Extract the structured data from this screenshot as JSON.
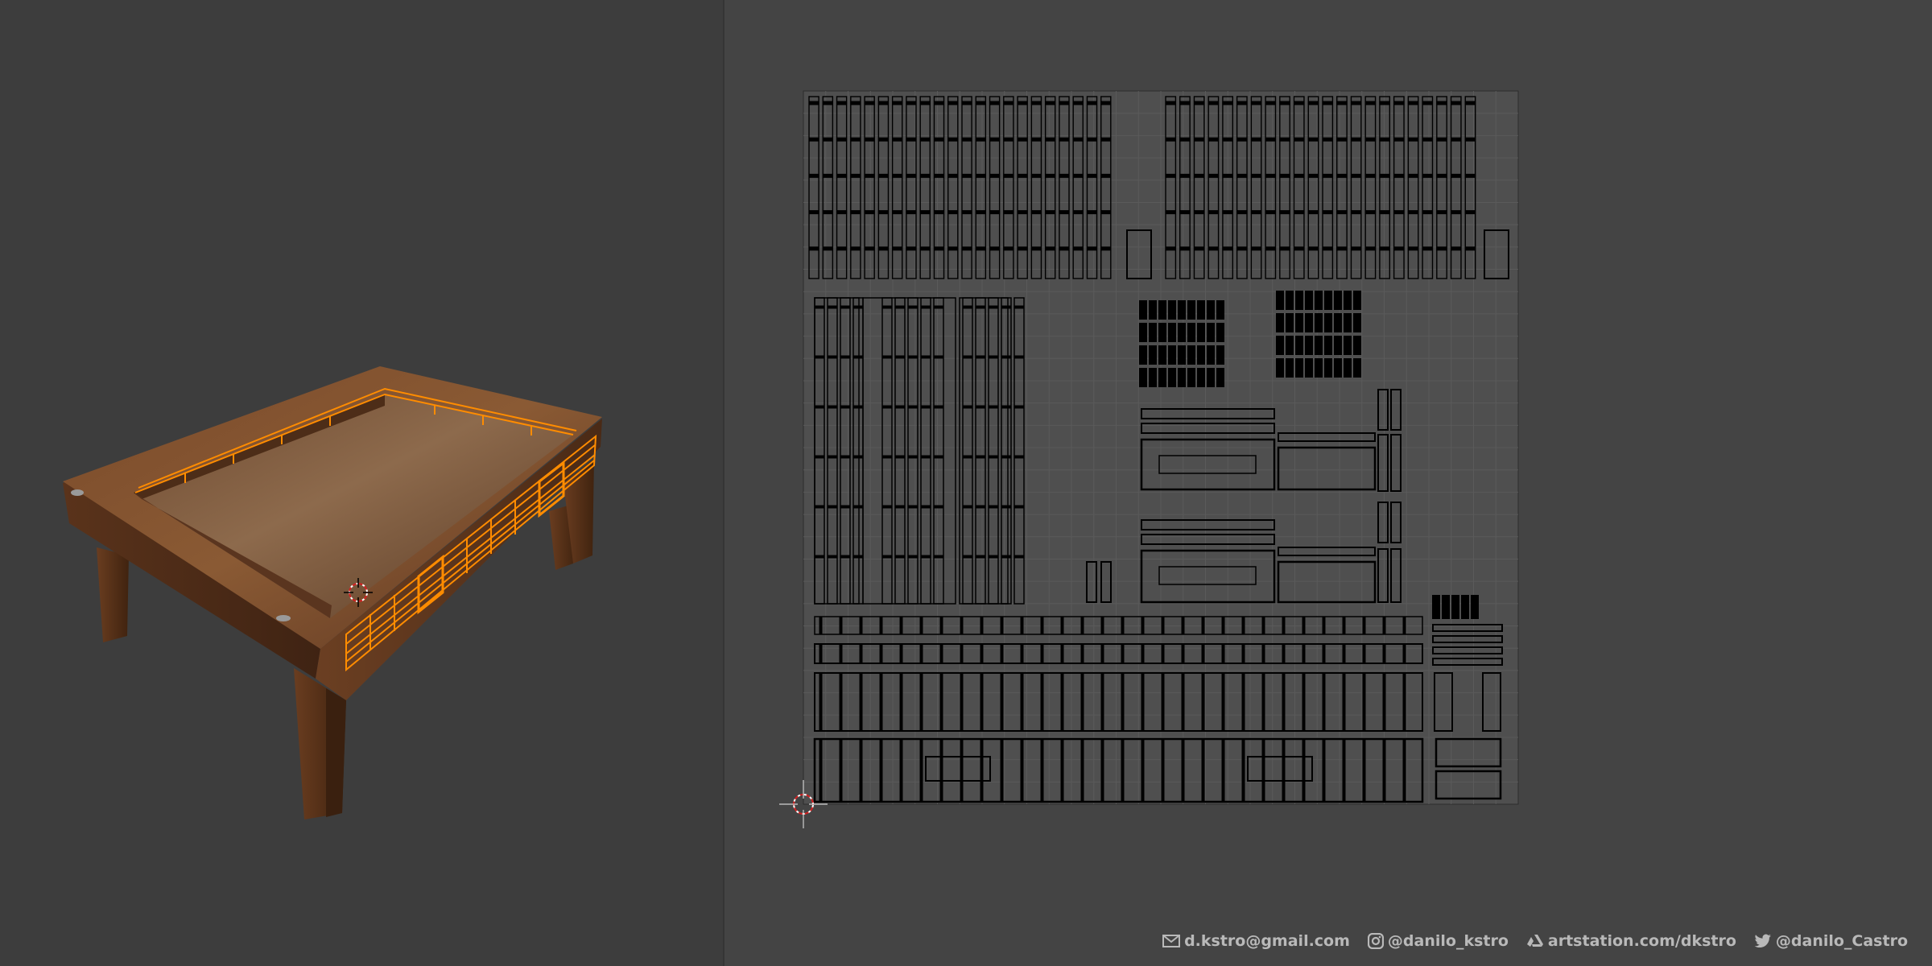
{
  "viewport": {
    "background": "#3d3d3d",
    "wood_color": "#6b3f22",
    "selection_color": "#ff8c00",
    "cursor_icon": "3d-cursor-icon"
  },
  "uv_editor": {
    "background": "#444444",
    "grid_color": "#5a5a5a",
    "island_color": "#000000",
    "cursor_icon": "2d-cursor-icon"
  },
  "footer": {
    "email": "d.kstro@gmail.com",
    "instagram": "@danilo_kstro",
    "artstation": "artstation.com/dkstro",
    "twitter": "@danilo_Castro",
    "icons": [
      "mail-icon",
      "instagram-icon",
      "artstation-icon",
      "twitter-icon"
    ]
  }
}
